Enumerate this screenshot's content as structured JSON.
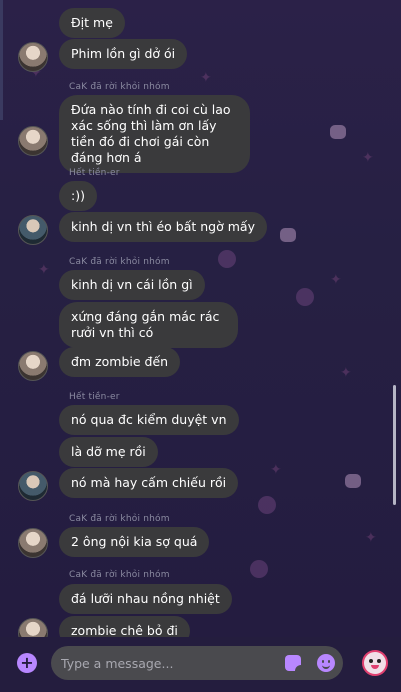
{
  "messages": [
    {
      "text": "Địt mẹ"
    },
    {
      "text": "Phim lồn gì dở ói"
    },
    {
      "text": "Đứa nào tính đi coi cù lao xác sống thì làm ơn lấy tiền đó đi chơi gái còn đáng hơn á"
    },
    {
      "text": ":))"
    },
    {
      "text": "kinh dị vn thì éo bất ngờ mấy"
    },
    {
      "text": "kinh dị vn cái lồn gì"
    },
    {
      "text": "xứng đáng gắn mác rác rưởi vn thì có"
    },
    {
      "text": "đm zombie đến"
    },
    {
      "text": "nó qua đc kiểm duyệt vn"
    },
    {
      "text": "là dỡ mẹ rồi"
    },
    {
      "text": "nó mà hay cấm chiếu rồi"
    },
    {
      "text": "2 ông nội kia sợ quá"
    },
    {
      "text": "đá lưỡi nhau nồng nhiệt"
    },
    {
      "text": "zombie chê bỏ đi"
    }
  ],
  "system": {
    "left_1": "CaK đã rời khỏi nhóm",
    "tienner_1": "Hết tiền-er",
    "left_2": "CaK đã rời khỏi nhóm",
    "tienner_2": "Hết tiền-er",
    "left_3": "CaK đã rời khỏi nhóm",
    "left_4": "CaK đã rời khỏi nhóm"
  },
  "composer": {
    "placeholder": "Type a message...",
    "icons": {
      "add": "plus-circle-icon",
      "sticker": "sticker-icon",
      "emoji": "smile-icon",
      "reaction": "custom-reaction-icon"
    }
  },
  "colors": {
    "background": "#261f43",
    "bubble": "#3a3a3c",
    "accent": "#b887ff"
  }
}
